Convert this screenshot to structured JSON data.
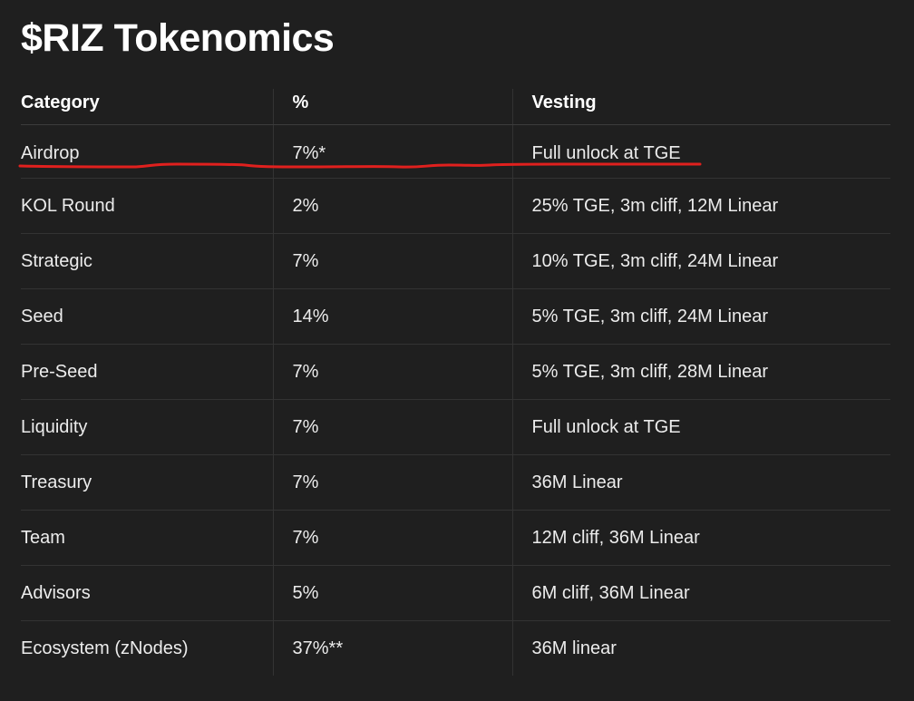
{
  "title": "$RIZ Tokenomics",
  "table": {
    "headers": [
      "Category",
      "%",
      "Vesting"
    ],
    "rows": [
      {
        "category": "Airdrop",
        "percent": "7%*",
        "vesting": "Full unlock at TGE"
      },
      {
        "category": "KOL Round",
        "percent": "2%",
        "vesting": "25% TGE, 3m cliff, 12M Linear"
      },
      {
        "category": "Strategic",
        "percent": "7%",
        "vesting": "10% TGE, 3m cliff, 24M Linear"
      },
      {
        "category": "Seed",
        "percent": "14%",
        "vesting": "5% TGE, 3m cliff, 24M Linear"
      },
      {
        "category": "Pre-Seed",
        "percent": "7%",
        "vesting": "5% TGE, 3m cliff, 28M Linear"
      },
      {
        "category": "Liquidity",
        "percent": "7%",
        "vesting": "Full unlock at TGE"
      },
      {
        "category": "Treasury",
        "percent": "7%",
        "vesting": "36M Linear"
      },
      {
        "category": "Team",
        "percent": "7%",
        "vesting": "12M cliff, 36M Linear"
      },
      {
        "category": "Advisors",
        "percent": "5%",
        "vesting": "6M cliff, 36M Linear"
      },
      {
        "category": "Ecosystem (zNodes)",
        "percent": "37%**",
        "vesting": "36M linear"
      }
    ]
  },
  "colors": {
    "background": "#1f1f1f",
    "text": "#ececec",
    "heading": "#ffffff",
    "divider": "#333333",
    "annotation": "#e0201e"
  },
  "annotation": {
    "type": "hand-drawn-underline",
    "target_row": 0
  }
}
